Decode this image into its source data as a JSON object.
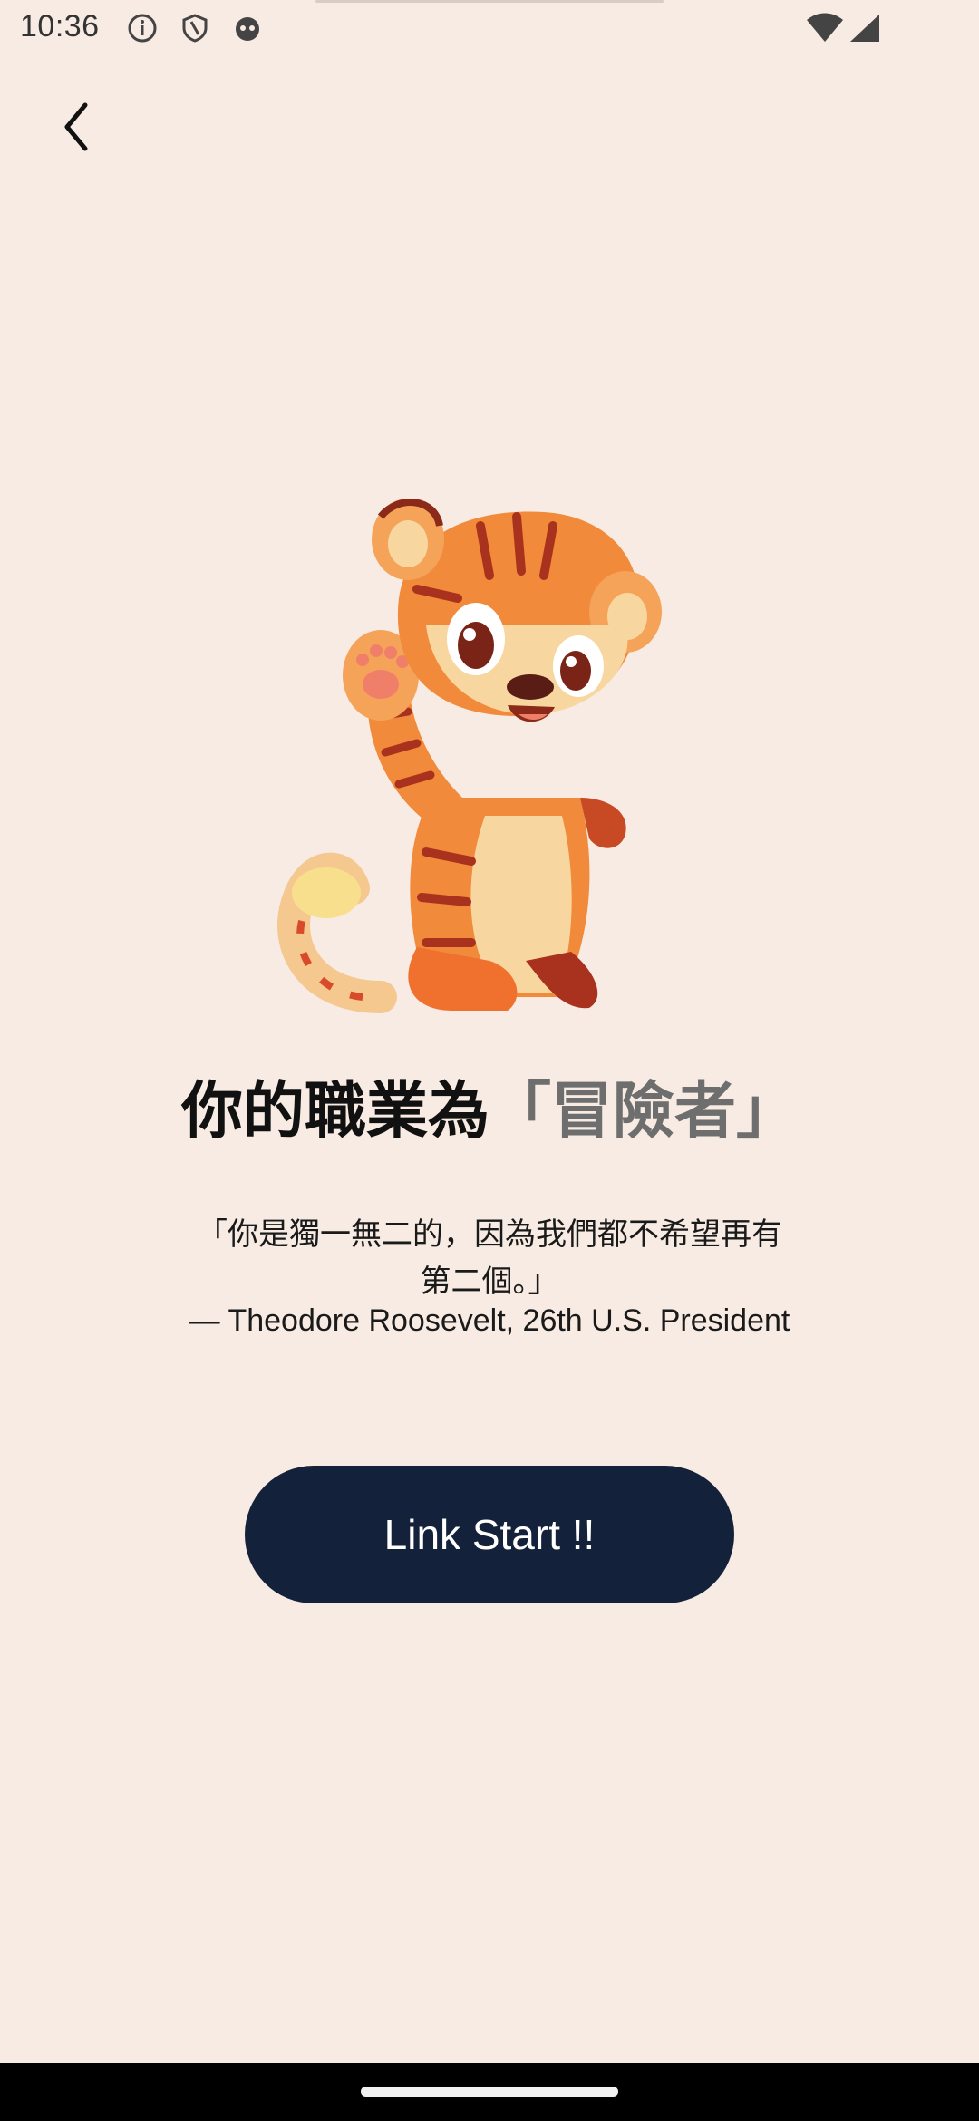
{
  "status_bar": {
    "time": "10:36",
    "left_icons": [
      "info-icon",
      "shield-icon",
      "face-icon"
    ],
    "right_icons": [
      "wifi-icon",
      "cellular-signal-icon"
    ]
  },
  "nav": {
    "back_icon": "chevron-left-icon"
  },
  "mascot": {
    "icon": "tiger-mascot-illustration"
  },
  "result": {
    "title_prefix": "你的職業為",
    "title_role": "「冒險者」",
    "quote_line1": "「你是獨一無二的，因為我們都不希望再有",
    "quote_line2": "第二個。」",
    "quote_author": "— Theodore Roosevelt, 26th U.S. President"
  },
  "cta": {
    "label": "Link Start !!"
  },
  "colors": {
    "background": "#f7ebe3",
    "button": "#13213a",
    "title_accent": "#6e6e6e"
  }
}
